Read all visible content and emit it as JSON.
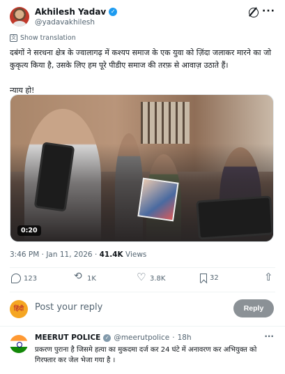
{
  "author": {
    "name": "Akhilesh Yadav",
    "handle": "@yadavakhilesh"
  },
  "icons": {
    "verified": "✓",
    "grok": "grok-icon",
    "more": "···"
  },
  "translate": {
    "label": "Show translation",
    "icon": "文"
  },
  "tweet": {
    "paragraph1": "दबंगों ने सरधना क्षेत्र के ज्वालागढ़ में कश्यप समाज के एक युवा को ज़िंदा जलाकर मारने का जो कुकृत्य किया है, उसके लिए हम पूरे पीडीए समाज की तरफ़ से आवाज़ उठाते हैं।",
    "paragraph2": "न्याय हो!"
  },
  "media": {
    "duration": "0:20"
  },
  "meta": {
    "time": "3:46 PM",
    "separator": " · ",
    "date": "Jan 11, 2026",
    "views_count": "41.4K",
    "views_label": " Views"
  },
  "actions": {
    "replies": "123",
    "reposts": "1K",
    "likes": "3.8K",
    "bookmarks": "32"
  },
  "compose": {
    "avatar_text": "हिंदी",
    "placeholder": "Post your reply",
    "button": "Reply"
  },
  "comment": {
    "name": "MEERUT POLICE",
    "handle": "@meerutpolice",
    "separator": "·",
    "time": "18h",
    "text": "प्रकरण पुराना है जिसमे हत्या का मुकदमा दर्ज कर 24 घंटे में अनावरण कर अभियुक्त को गिरफ्तार कर जेल भेजा गया है ।"
  },
  "colors": {
    "accent": "#1d9bf0",
    "muted": "#536471",
    "reply_button": "#8b9196"
  }
}
